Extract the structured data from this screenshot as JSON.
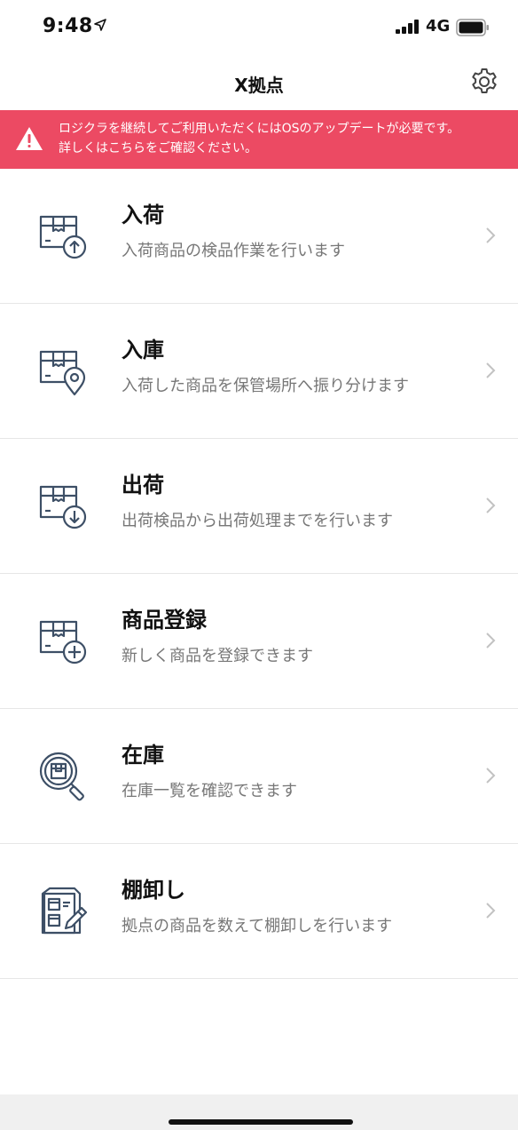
{
  "status_bar": {
    "time": "9:48",
    "network": "4G",
    "icons": [
      "location-arrow-icon",
      "signal-icon",
      "battery-icon"
    ]
  },
  "nav": {
    "title": "X拠点",
    "settings_icon": "gear-icon"
  },
  "alert": {
    "line1": "ロジクラを継続してご利用いただくにはOSのアップデートが必要です。",
    "line2": "詳しくはこちらをご確認ください。",
    "icon": "warning-icon",
    "background": "#ec4a63"
  },
  "menu": {
    "items": [
      {
        "title": "入荷",
        "description": "入荷商品の検品作業を行います",
        "icon": "box-arrow-up-icon"
      },
      {
        "title": "入庫",
        "description": "入荷した商品を保管場所へ振り分けます",
        "icon": "box-location-pin-icon"
      },
      {
        "title": "出荷",
        "description": "出荷検品から出荷処理までを行います",
        "icon": "box-arrow-down-icon"
      },
      {
        "title": "商品登録",
        "description": "新しく商品を登録できます",
        "icon": "box-plus-icon"
      },
      {
        "title": "在庫",
        "description": "在庫一覧を確認できます",
        "icon": "magnifier-box-icon"
      },
      {
        "title": "棚卸し",
        "description": "拠点の商品を数えて棚卸しを行います",
        "icon": "clipboard-pencil-icon"
      }
    ]
  },
  "colors": {
    "icon_stroke": "#3d4f66",
    "alert_background": "#ec4a63",
    "description_text": "#777777"
  }
}
